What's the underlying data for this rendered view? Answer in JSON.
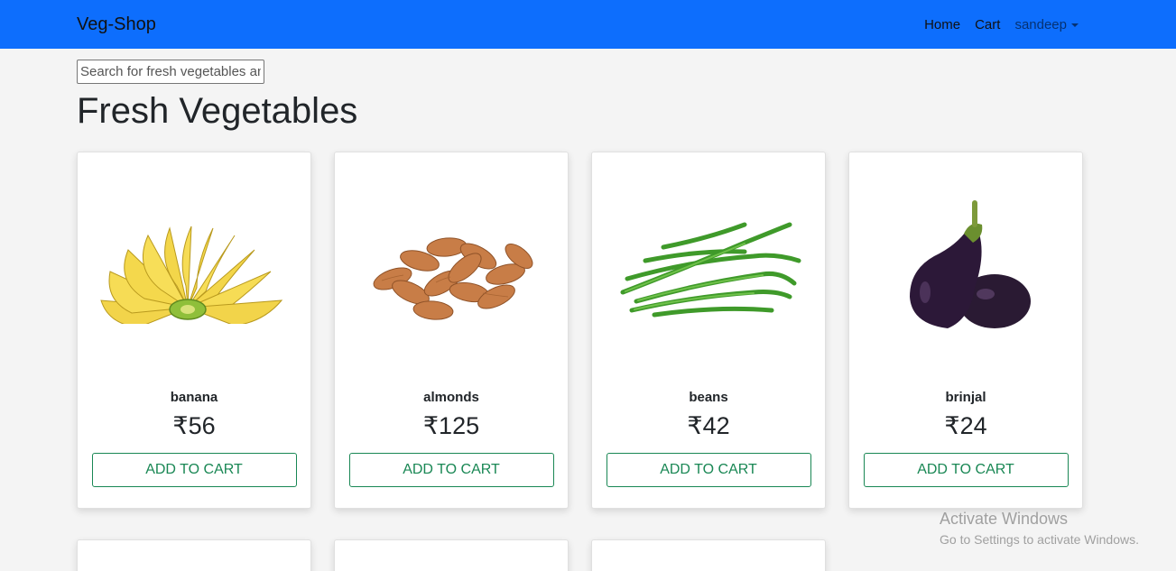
{
  "navbar": {
    "brand": "Veg-Shop",
    "links": {
      "home": "Home",
      "cart": "Cart"
    },
    "user": "sandeep",
    "bg_color": "#0d6efd"
  },
  "search": {
    "placeholder": "Search for fresh vegetables and fruits",
    "value": ""
  },
  "page_title": "Fresh Vegetables",
  "products": [
    {
      "name": "banana",
      "price": "₹56",
      "button_label": "ADD TO CART",
      "image": "banana-image"
    },
    {
      "name": "almonds",
      "price": "₹125",
      "button_label": "ADD TO CART",
      "image": "almonds-image"
    },
    {
      "name": "beans",
      "price": "₹42",
      "button_label": "ADD TO CART",
      "image": "beans-image"
    },
    {
      "name": "brinjal",
      "price": "₹24",
      "button_label": "ADD TO CART",
      "image": "brinjal-image"
    }
  ],
  "watermark": {
    "title": "Activate Windows",
    "subtitle": "Go to Settings to activate Windows."
  },
  "colors": {
    "accent": "#0d6efd",
    "button": "#198754",
    "background": "#f4f4f4"
  }
}
